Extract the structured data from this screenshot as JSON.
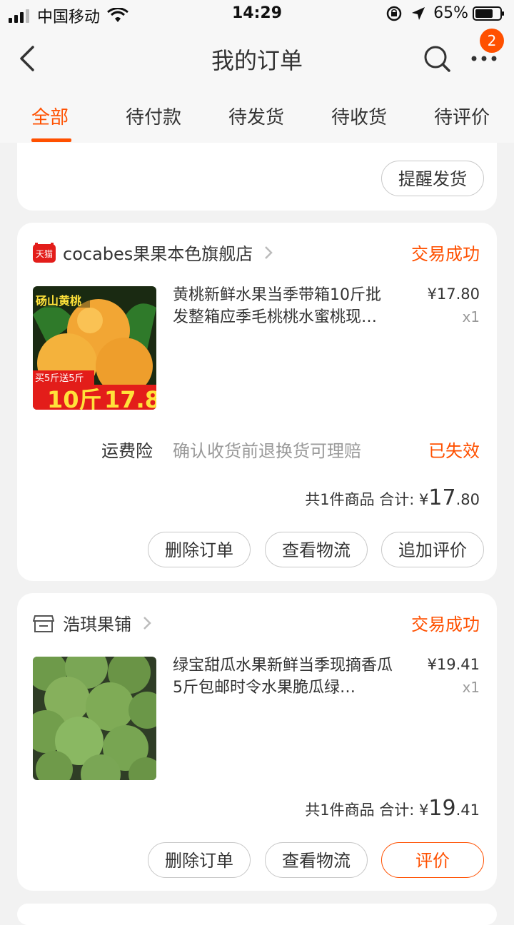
{
  "statusbar": {
    "carrier": "中国移动",
    "time": "14:29",
    "battery": "65%"
  },
  "nav": {
    "title": "我的订单",
    "badge_count": "2"
  },
  "tabs": [
    "全部",
    "待付款",
    "待发货",
    "待收货",
    "待评价"
  ],
  "partial_card": {
    "remind_button": "提醒发货"
  },
  "orders": [
    {
      "shop_name": "cocabes果果本色旗舰店",
      "status": "交易成功",
      "product_title": "黄桃新鲜水果当季带箱10斤批发整箱应季毛桃桃水蜜桃现…",
      "price": "¥17.80",
      "qty": "x1",
      "insurance_label": "运费险",
      "insurance_desc": "确认收货前退换货可理赔",
      "insurance_status": "已失效",
      "total_prefix": "共1件商品 合计: ¥",
      "total_int": "17",
      "total_dec": ".80",
      "buttons": [
        "删除订单",
        "查看物流",
        "追加评价"
      ],
      "thumb_text": {
        "top": "砀山黄桃",
        "promo": "买5斤送5斤",
        "weight": "10斤",
        "price": "17.8"
      }
    },
    {
      "shop_name": "浩琪果铺",
      "status": "交易成功",
      "product_title": "绿宝甜瓜水果新鲜当季现摘香瓜5斤包邮时令水果脆瓜绿…",
      "price": "¥19.41",
      "qty": "x1",
      "total_prefix": "共1件商品 合计: ¥",
      "total_int": "19",
      "total_dec": ".41",
      "buttons": [
        "删除订单",
        "查看物流",
        "评价"
      ]
    }
  ],
  "colors": {
    "accent": "#ff5000",
    "tmall_red": "#e31d1a",
    "background": "#f2f2f2"
  },
  "icons": [
    "signal-icon",
    "wifi-icon",
    "lock-rotation-icon",
    "location-arrow-icon",
    "battery-icon",
    "back-icon",
    "search-icon",
    "more-icon",
    "tmall-icon",
    "store-icon",
    "chevron-right-icon"
  ]
}
